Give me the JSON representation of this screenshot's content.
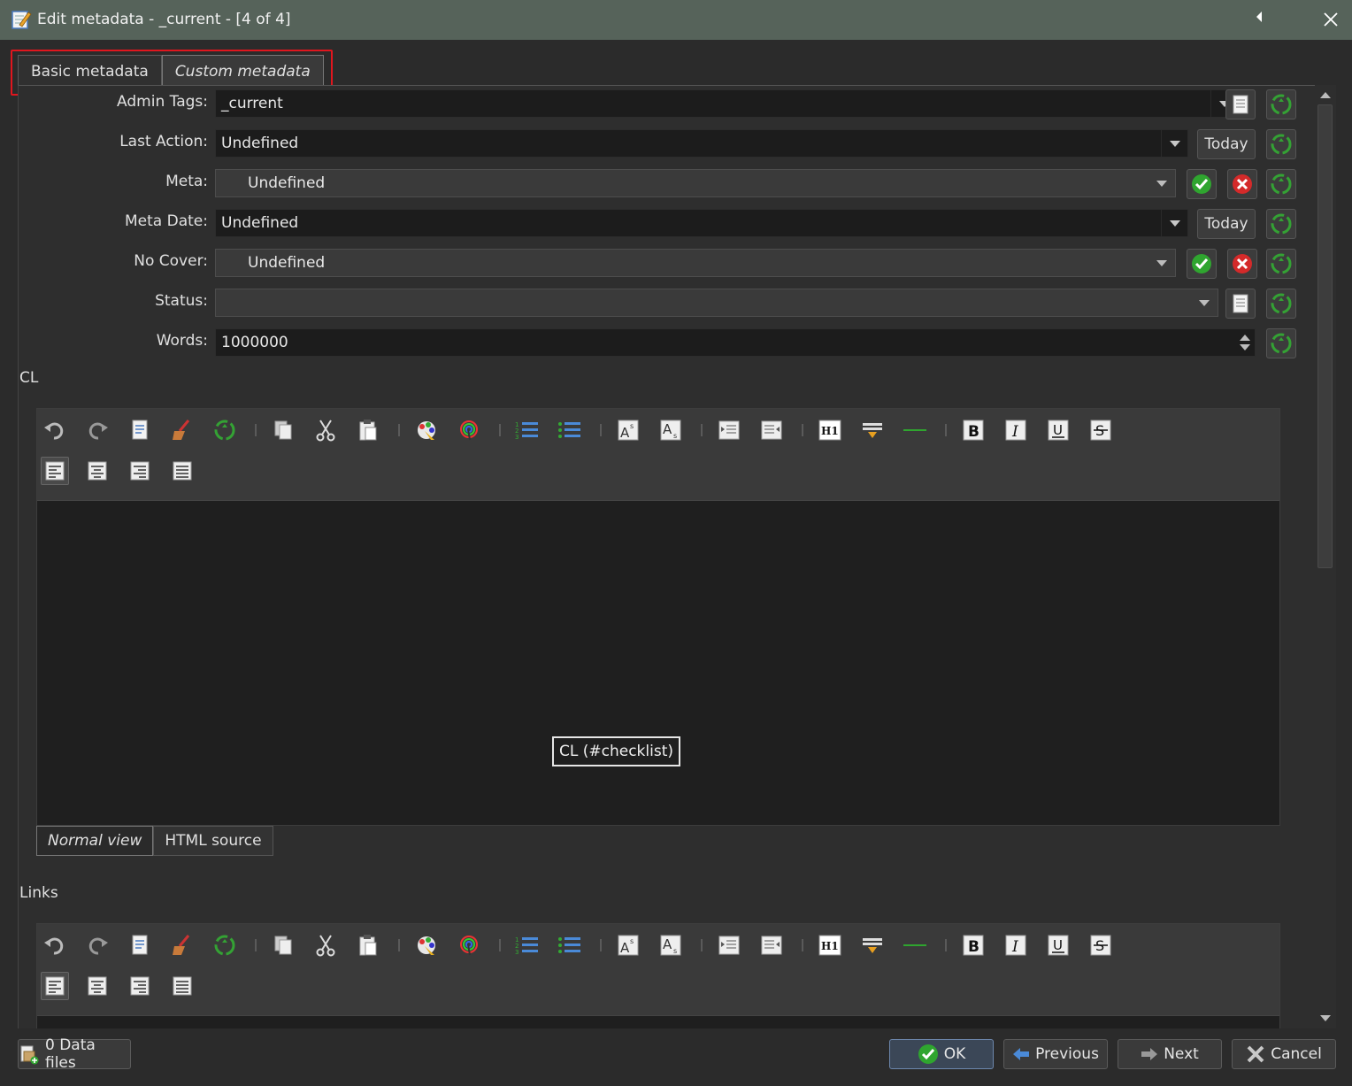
{
  "window": {
    "title": "Edit metadata - _current - [4 of 4]"
  },
  "tabs": [
    {
      "label": "Basic metadata",
      "active": false
    },
    {
      "label": "Custom metadata",
      "active": true
    }
  ],
  "fields": {
    "admin_tags": {
      "label": "Admin Tags:",
      "value": "_current"
    },
    "last_action": {
      "label": "Last Action:",
      "value": "Undefined",
      "button": "Today"
    },
    "meta": {
      "label": "Meta:",
      "value": "Undefined"
    },
    "meta_date": {
      "label": "Meta Date:",
      "value": "Undefined",
      "button": "Today"
    },
    "no_cover": {
      "label": "No Cover:",
      "value": "Undefined"
    },
    "status": {
      "label": "Status:",
      "value": ""
    },
    "words": {
      "label": "Words:",
      "value": "1000000"
    }
  },
  "editors": {
    "cl": {
      "label": "CL",
      "tooltip": "CL (#checklist)",
      "view_tabs": [
        "Normal view",
        "HTML source"
      ]
    },
    "links": {
      "label": "Links"
    }
  },
  "toolbar_icons": [
    "undo-icon",
    "redo-icon",
    "select-all-icon",
    "clear-icon",
    "recycle-icon",
    "copy-icon",
    "cut-icon",
    "paste-icon",
    "foreground-color-icon",
    "background-color-icon",
    "numbered-list-icon",
    "bulleted-list-icon",
    "superscript-icon",
    "subscript-icon",
    "indent-icon",
    "outdent-icon",
    "heading-icon",
    "insert-link-icon",
    "horizontal-rule-icon",
    "bold-icon",
    "italic-icon",
    "underline-icon",
    "strikethrough-icon"
  ],
  "align_icons": [
    "align-left-icon",
    "align-center-icon",
    "align-right-icon",
    "align-justify-icon"
  ],
  "bottom": {
    "data_files": "0 Data files",
    "ok": "OK",
    "previous": "Previous",
    "next": "Next",
    "cancel": "Cancel"
  },
  "colors": {
    "titlebar": "#56635a",
    "highlight": "#e0161e",
    "accept": "#2fa52f",
    "reject": "#d42a2a",
    "recycle": "#34a234"
  }
}
